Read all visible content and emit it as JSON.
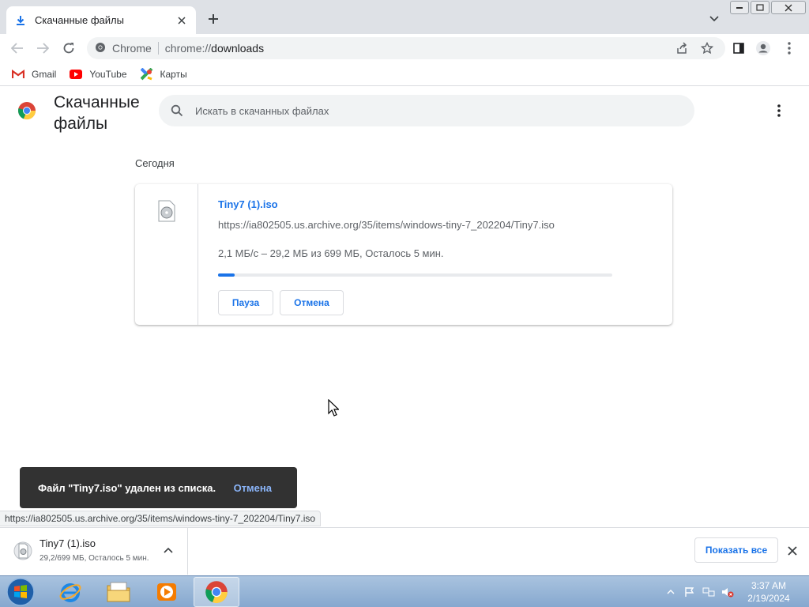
{
  "browser": {
    "tab": {
      "title": "Скачанные файлы",
      "icon": "download-icon"
    },
    "address": {
      "site_label": "Chrome",
      "url_prefix": "chrome://",
      "url_main": "downloads"
    },
    "bookmarks": [
      {
        "label": "Gmail",
        "icon": "gmail-icon"
      },
      {
        "label": "YouTube",
        "icon": "youtube-icon"
      },
      {
        "label": "Карты",
        "icon": "maps-icon"
      }
    ]
  },
  "downloads_page": {
    "title": "Скачанные файлы",
    "search_placeholder": "Искать в скачанных файлах",
    "date_group": "Сегодня",
    "item": {
      "file_name": "Tiny7 (1).iso",
      "url": "https://ia802505.us.archive.org/35/items/windows-tiny-7_202204/Tiny7.iso",
      "status": "2,1 МБ/с – 29,2 МБ из 699 МБ, Осталось 5 мин.",
      "progress_percent": 4.2,
      "pause_label": "Пауза",
      "cancel_label": "Отмена"
    }
  },
  "toast": {
    "message": "Файл \"Tiny7.iso\" удален из списка.",
    "action": "Отмена"
  },
  "status_bar_url": "https://ia802505.us.archive.org/35/items/windows-tiny-7_202204/Tiny7.iso",
  "shelf": {
    "file_name": "Tiny7 (1).iso",
    "status": "29,2/699 МБ, Осталось 5 мин.",
    "show_all_label": "Показать все"
  },
  "taskbar": {
    "time": "3:37 AM",
    "date": "2/19/2024",
    "apps": [
      "internet-explorer-icon",
      "file-explorer-icon",
      "media-player-icon",
      "chrome-icon"
    ]
  },
  "colors": {
    "accent": "#1a73e8",
    "toast_bg": "#323232",
    "toast_action": "#8ab4f8",
    "tabstrip_bg": "#dee1e6"
  }
}
